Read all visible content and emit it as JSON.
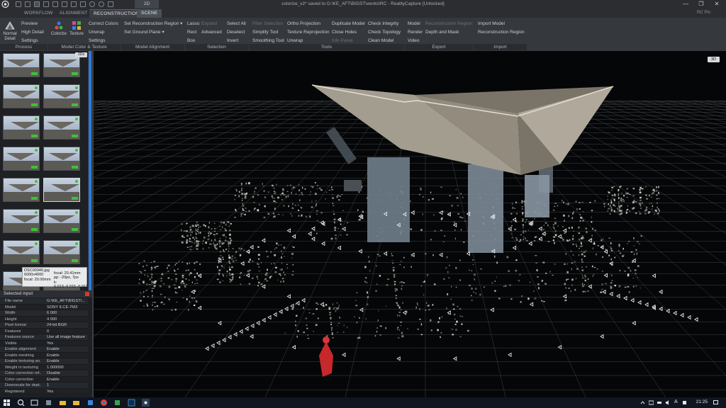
{
  "window": {
    "title": "colorize_v2* saved to G:\\KE_AFT\\BIGST\\works\\RC - RealityCapture [Unlocked]",
    "tab_2d": "2D",
    "controls": [
      "—",
      "❐",
      "✕"
    ]
  },
  "ribbon_tabs": [
    "WORKFLOW",
    "ALIGNMENT",
    "RECONSTRUCTION",
    "SCENE"
  ],
  "active_tab": "RECONSTRUCTION",
  "rc_pin": "RC Pin",
  "ribbon": {
    "normal_detail": "Normal Detail",
    "process": {
      "items": [
        "Preview",
        "High Detail",
        "Settings"
      ],
      "label": "Process"
    },
    "model_color": {
      "colorize": "Colorize",
      "texture": "Texture",
      "items": [
        "Correct Colors",
        "Unwrap",
        "Settings"
      ],
      "label": "Model Color & Texture"
    },
    "model_alignment": {
      "items": [
        "Set Reconstruction Region",
        "Set Ground Plane"
      ],
      "label": "Model Alignment"
    },
    "selection": {
      "col1": [
        "Lasso",
        "Rect",
        "Box"
      ],
      "col2": [
        "Expand",
        "Advanced"
      ],
      "col3": [
        "Select All",
        "Deselect",
        "Invert"
      ],
      "label": "Selection"
    },
    "tools": {
      "col1": [
        "Filter Selection",
        "Simplify Tool",
        "Smoothing Tool"
      ],
      "col2": [
        "Ortho Projection",
        "Texture Reprojection",
        "Unwrap"
      ],
      "col3": [
        "Duplicate Model",
        "Close Holes",
        "Info Panel"
      ],
      "col4": [
        "Check Integrity",
        "Check Topology",
        "Clean Model"
      ],
      "label": "Tools"
    },
    "export": {
      "col1": [
        "Model",
        "Render",
        "Video"
      ],
      "col2": [
        "Reconstruction Region",
        "Depth and Mask"
      ],
      "label": "Export"
    },
    "import": {
      "items": [
        "Import Model",
        "Reconstruction Region"
      ],
      "label": "Import"
    }
  },
  "thumb_panel": {
    "tag": "2Ds"
  },
  "tooltip": {
    "filename": "DSC00046.jpg",
    "size": "6000x4000",
    "focal_left": "focal: 20.00mm",
    "focal": "focal: 20.41mm",
    "pp": "pp: -20px, 7px",
    "k": "k: 0.013,-0.015,-0.011"
  },
  "selected_input": {
    "header": "Selected input",
    "rows": [
      {
        "k": "File name",
        "v": "G:\\KE_AFT\\BIGST\\..."
      },
      {
        "k": "Model",
        "v": "SONY ILCE-7M3"
      },
      {
        "k": "Width",
        "v": "6 000"
      },
      {
        "k": "Height",
        "v": "4 000"
      },
      {
        "k": "Pixel format",
        "v": "24-bit BGR"
      },
      {
        "k": "Features",
        "v": "0"
      },
      {
        "k": "Features source",
        "v": "Use all image features"
      },
      {
        "k": "Visible",
        "v": "Yes"
      },
      {
        "k": "Enable alignment",
        "v": "Enable"
      },
      {
        "k": "Enable meshing",
        "v": "Enable"
      },
      {
        "k": "Enable texturing an...",
        "v": "Enable"
      },
      {
        "k": "Weight in texturing",
        "v": "1.000000"
      },
      {
        "k": "Color correction ref...",
        "v": "Disable"
      },
      {
        "k": "Color correction",
        "v": "Enable"
      },
      {
        "k": "Downscale for dept...",
        "v": "1"
      },
      {
        "k": "Registered",
        "v": "Yes"
      }
    ]
  },
  "viewport": {
    "badge": "3D"
  },
  "taskbar": {
    "time": "21:25",
    "lang": "A"
  },
  "colors": {
    "accent": "#2f7ad8",
    "status_green": "#3fc136",
    "close_red": "#d23a35"
  }
}
